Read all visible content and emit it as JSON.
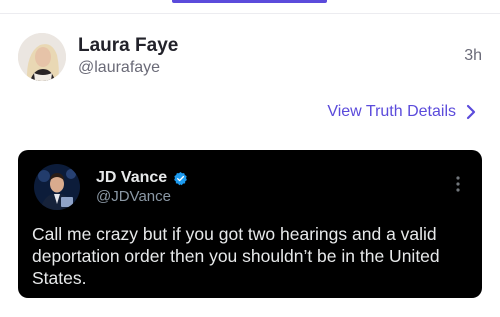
{
  "post": {
    "author_name": "Laura Faye",
    "author_handle": "@laurafaye",
    "time_ago": "3h",
    "view_details_label": "View Truth Details"
  },
  "embed": {
    "name": "JD Vance",
    "handle": "@JDVance",
    "text": "Call me crazy but if you got two hearings and a valid deportation order then you shouldn’t be in the United States."
  },
  "icons": {
    "chevron": "chevron-right-icon",
    "verified": "verified-badge-icon",
    "more": "more-vertical-icon"
  },
  "colors": {
    "accent": "#5b4bdb",
    "embed_background": "#000000",
    "verified": "#1d9bf0"
  }
}
